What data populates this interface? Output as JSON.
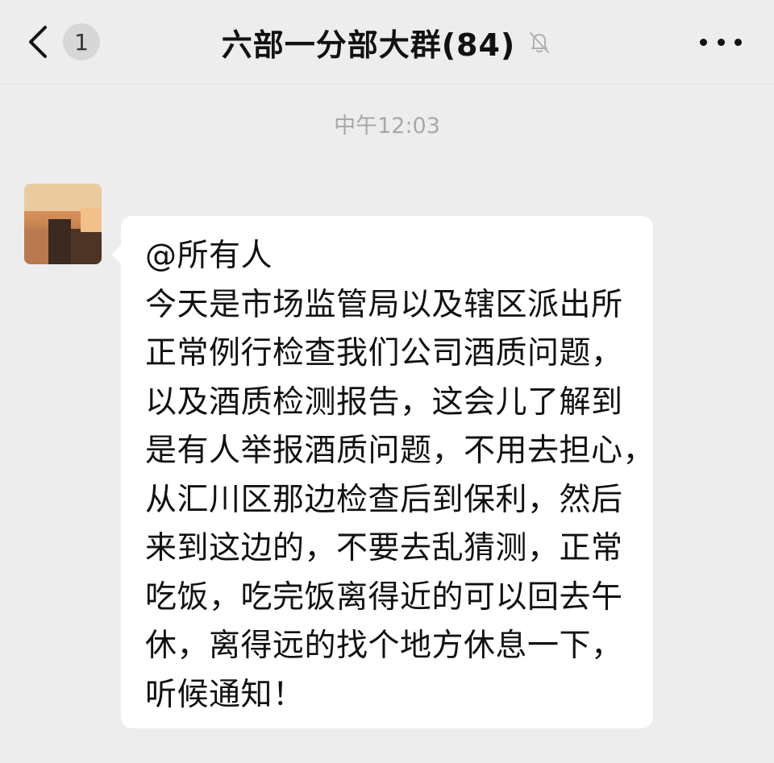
{
  "header": {
    "back_badge": "1",
    "title": "六部一分部大群(84)",
    "icons": {
      "back": "chevron-left-icon",
      "mute": "bell-off-icon",
      "more": "more-dots-icon"
    }
  },
  "chat": {
    "timestamp": "中午12:03",
    "message": {
      "lines": [
        "@所有人",
        "今天是市场监管局以及辖区派出所",
        "正常例行检查我们公司酒质问题，",
        "以及酒质检测报告，这会儿了解到",
        "是有人举报酒质问题，不用去担心，",
        "从汇川区那边检查后到保利，然后",
        "来到这边的，不要去乱猜测，正常",
        "吃饭，吃完饭离得近的可以回去午",
        "休，离得远的找个地方休息一下，",
        "听候通知！"
      ]
    }
  },
  "colors": {
    "background": "#ededed",
    "bubble": "#ffffff",
    "timestamp": "#a8a8a8",
    "badge": "#d7d7d7"
  }
}
